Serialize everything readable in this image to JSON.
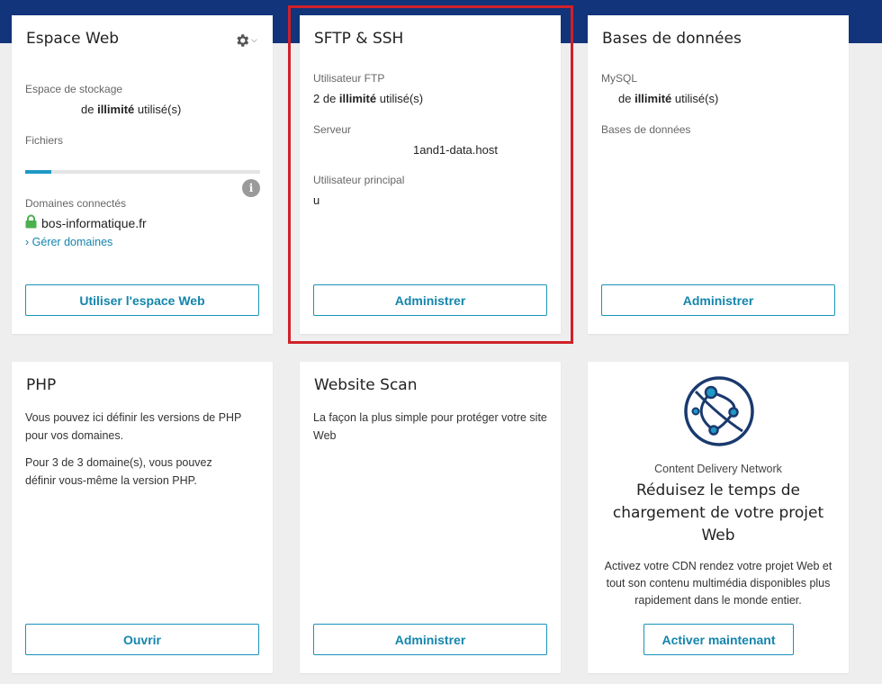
{
  "cards": {
    "espace_web": {
      "title": "Espace Web",
      "storage_label": "Espace de stockage",
      "storage_prefix": "de ",
      "storage_bold": "illimité",
      "storage_suffix": " utilisé(s)",
      "files_label": "Fichiers",
      "files_progress": 0.11,
      "domains_label": "Domaines connectés",
      "domain": "bos-informatique.fr",
      "manage_link": "Gérer domaines",
      "button": "Utiliser l'espace Web"
    },
    "sftp": {
      "title": "SFTP & SSH",
      "ftp_user_label": "Utilisateur FTP",
      "ftp_prefix": "2 de ",
      "ftp_bold": "illimité",
      "ftp_suffix": " utilisé(s)",
      "server_label": "Serveur",
      "server_value": "1and1-data.host",
      "main_user_label": "Utilisateur principal",
      "main_user_value": "u",
      "button": "Administrer"
    },
    "databases": {
      "title": "Bases de données",
      "mysql_label": "MySQL",
      "mysql_prefix": "de ",
      "mysql_bold": "illimité",
      "mysql_suffix": " utilisé(s)",
      "db_label": "Bases de données",
      "button": "Administrer"
    },
    "php": {
      "title": "PHP",
      "desc1": "Vous pouvez ici définir les versions de PHP pour vos domaines.",
      "desc2": "Pour 3 de 3 domaine(s), vous pouvez définir vous-même la version PHP.",
      "button": "Ouvrir"
    },
    "scan": {
      "title": "Website Scan",
      "desc": "La façon la plus simple pour protéger votre site Web",
      "button": "Administrer"
    },
    "cdn": {
      "icon": "network-globe-icon",
      "eyebrow": "Content Delivery Network",
      "headline": "Réduisez le temps de chargement de votre projet Web",
      "desc": "Activez votre CDN rendez votre projet Web et tout son contenu multimédia disponibles plus rapidement dans le monde entier.",
      "button": "Activer maintenant"
    }
  },
  "colors": {
    "topbar": "#12347a",
    "accent": "#1485ad",
    "highlight": "#d0202a",
    "lock": "#4caf50"
  }
}
